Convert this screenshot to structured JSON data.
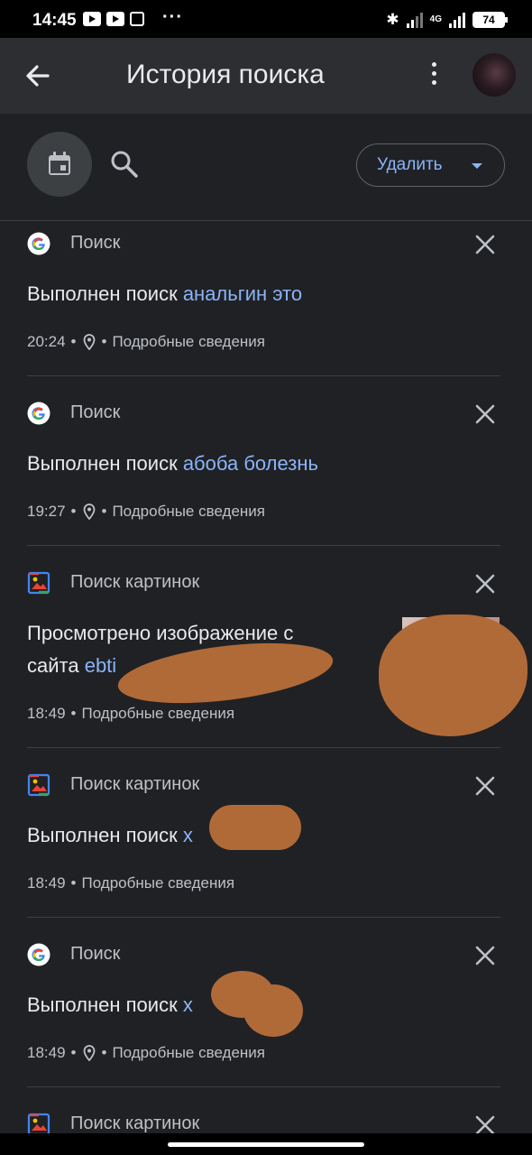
{
  "status_bar": {
    "time": "14:45",
    "battery": "74"
  },
  "app_bar": {
    "title": "История поиска"
  },
  "toolbar": {
    "delete_label": "Удалить"
  },
  "entries": [
    {
      "product": "Поиск",
      "icon": "google-g-icon",
      "prefix": "Выполнен поиск ",
      "query": "анальгин это",
      "time": "20:24",
      "has_location": true,
      "details": "Подробные сведения"
    },
    {
      "product": "Поиск",
      "icon": "google-g-icon",
      "prefix": "Выполнен поиск ",
      "query": "абоба болезнь",
      "time": "19:27",
      "has_location": true,
      "details": "Подробные сведения"
    },
    {
      "product": "Поиск картинок",
      "icon": "image-search-icon",
      "line1": "Просмотрено изображение с",
      "line2_prefix": "сайта ",
      "line2_link": "ebti",
      "time": "18:49",
      "has_location": false,
      "details": "Подробные сведения",
      "has_thumbnail": true
    },
    {
      "product": "Поиск картинок",
      "icon": "image-search-icon",
      "prefix": "Выполнен поиск ",
      "query": "х",
      "time": "18:49",
      "has_location": false,
      "details": "Подробные сведения"
    },
    {
      "product": "Поиск",
      "icon": "google-g-icon",
      "prefix": "Выполнен поиск ",
      "query": "х",
      "time": "18:49",
      "has_location": true,
      "details": "Подробные сведения"
    },
    {
      "product": "Поиск картинок",
      "icon": "image-search-icon"
    }
  ],
  "colors": {
    "background": "#202124",
    "appbar": "#2d2e31",
    "link": "#8ab4f8",
    "text": "#e8eaed",
    "secondary": "#bdc1c6"
  }
}
